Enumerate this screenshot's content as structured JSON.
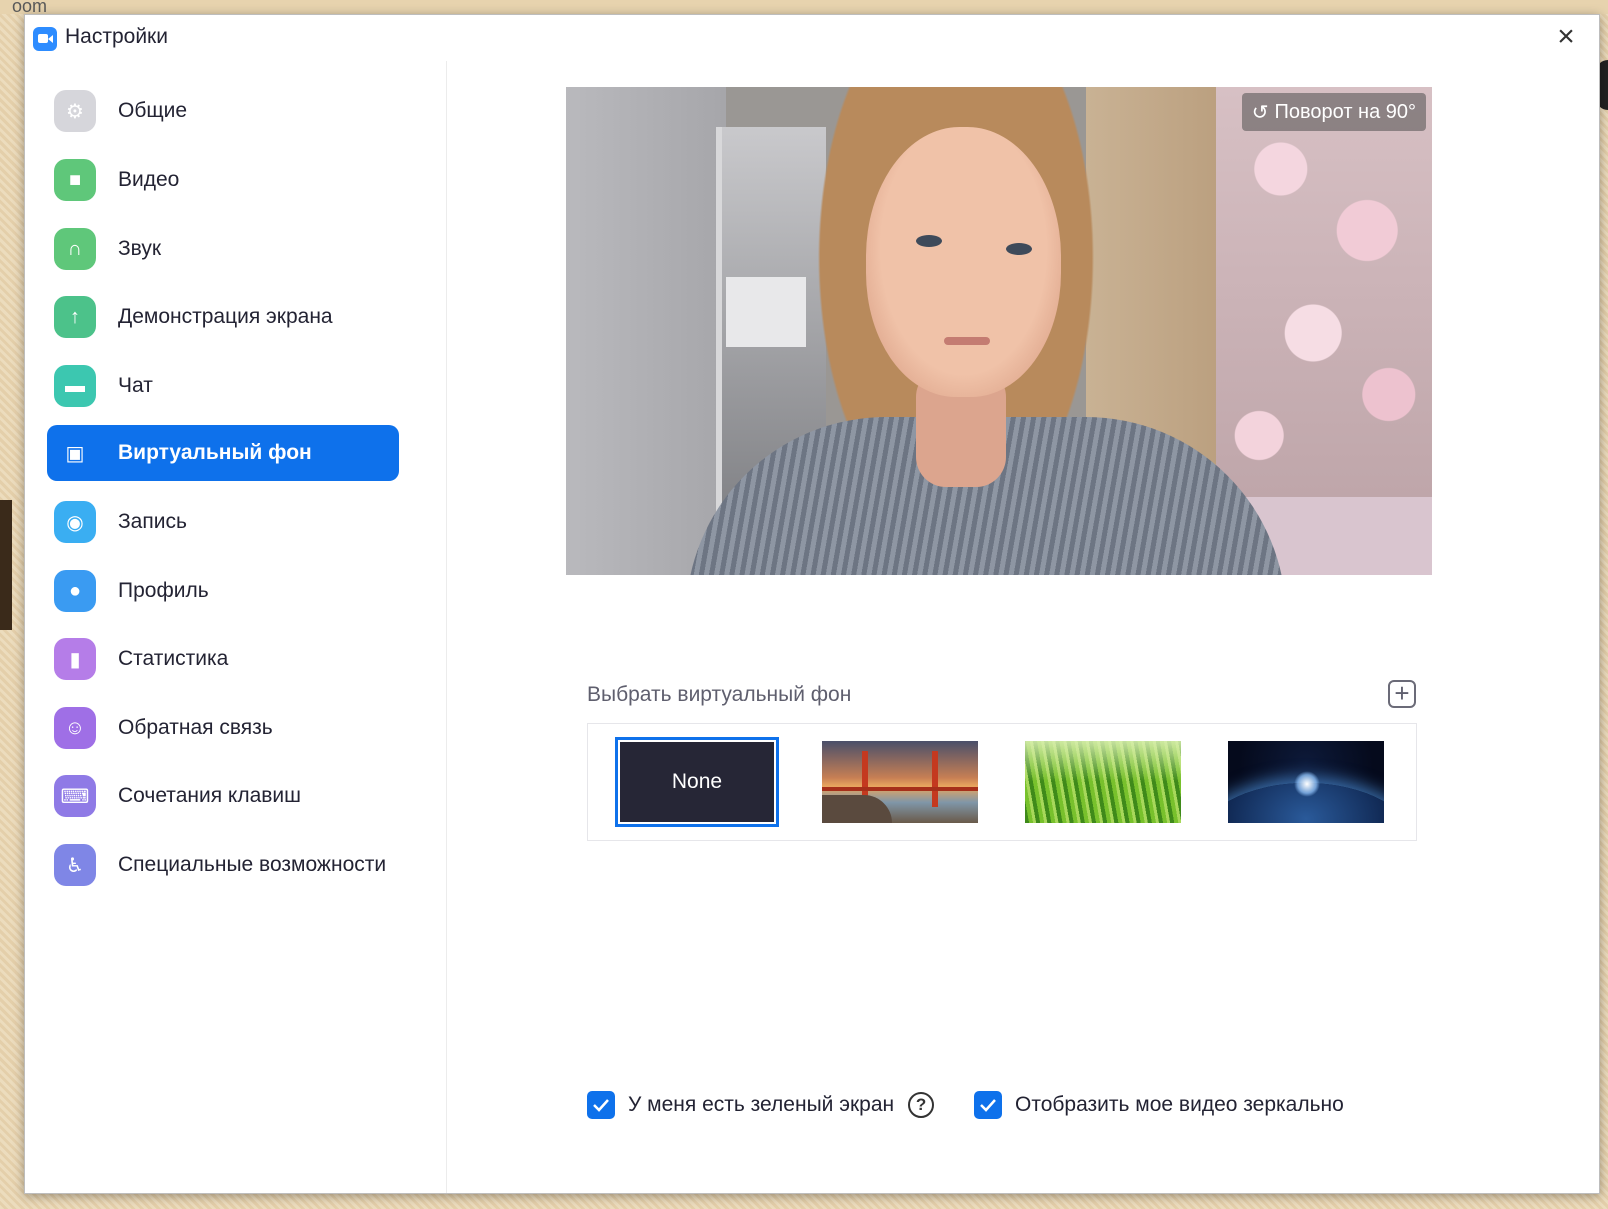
{
  "background": {
    "peek_text": "oom"
  },
  "window": {
    "title": "Настройки",
    "close_glyph": "×"
  },
  "sidebar": {
    "items": [
      {
        "label": "Общие",
        "icon": "gear-icon",
        "glyph": "⚙",
        "color": "#d6d6db",
        "active": false
      },
      {
        "label": "Видео",
        "icon": "video-camera-icon",
        "glyph": "■",
        "color": "#5fc77a",
        "active": false
      },
      {
        "label": "Звук",
        "icon": "headphones-icon",
        "glyph": "∩",
        "color": "#5fc77a",
        "active": false
      },
      {
        "label": "Демонстрация экрана",
        "icon": "share-screen-icon",
        "glyph": "↑",
        "color": "#4cc28a",
        "active": false
      },
      {
        "label": "Чат",
        "icon": "chat-bubble-icon",
        "glyph": "▬",
        "color": "#3cc7b0",
        "active": false
      },
      {
        "label": "Виртуальный фон",
        "icon": "virtual-background-icon",
        "glyph": "▣",
        "color": "#0e71eb",
        "active": true
      },
      {
        "label": "Запись",
        "icon": "record-icon",
        "glyph": "◉",
        "color": "#3aaef2",
        "active": false
      },
      {
        "label": "Профиль",
        "icon": "profile-icon",
        "glyph": "●",
        "color": "#3a9bf2",
        "active": false
      },
      {
        "label": "Статистика",
        "icon": "statistics-icon",
        "glyph": "▮",
        "color": "#b57de8",
        "active": false
      },
      {
        "label": "Обратная связь",
        "icon": "feedback-smiley-icon",
        "glyph": "☺",
        "color": "#9f6fe6",
        "active": false
      },
      {
        "label": "Сочетания клавиш",
        "icon": "keyboard-icon",
        "glyph": "⌨",
        "color": "#8f7ae6",
        "active": false
      },
      {
        "label": "Специальные возможности",
        "icon": "accessibility-icon",
        "glyph": "♿",
        "color": "#7f86e6",
        "active": false
      }
    ]
  },
  "preview": {
    "rotate_label": "Поворот на 90°",
    "rotate_glyph": "↺"
  },
  "virtual_bg": {
    "section_label": "Выбрать виртуальный фон",
    "add_glyph": "+",
    "none_label": "None",
    "selected": "None",
    "thumbnails": [
      "none",
      "golden-gate-bridge",
      "grass",
      "earth-from-space"
    ]
  },
  "options": {
    "green_screen": {
      "label": "У меня есть зеленый экран",
      "checked": true,
      "help_glyph": "?"
    },
    "mirror_video": {
      "label": "Отобразить мое видео зеркально",
      "checked": true
    }
  },
  "colors": {
    "accent": "#0e71eb",
    "text": "#232333",
    "muted": "#5f5f6e"
  }
}
